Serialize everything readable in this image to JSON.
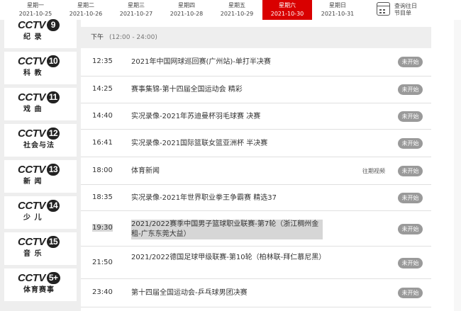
{
  "date_bar": {
    "days": [
      {
        "weekday": "星期一",
        "date": "2021-10-25",
        "active": false
      },
      {
        "weekday": "星期二",
        "date": "2021-10-26",
        "active": false
      },
      {
        "weekday": "星期三",
        "date": "2021-10-27",
        "active": false
      },
      {
        "weekday": "星期四",
        "date": "2021-10-28",
        "active": false
      },
      {
        "weekday": "星期五",
        "date": "2021-10-29",
        "active": false
      },
      {
        "weekday": "星期六",
        "date": "2021-10-30",
        "active": true
      },
      {
        "weekday": "星期日",
        "date": "2021-10-31",
        "active": false
      }
    ],
    "calendar_line1": "查询往日",
    "calendar_line2": "节目单",
    "active_color": "#d90000"
  },
  "channels": [
    {
      "logo": "CCTV",
      "num": "9",
      "sub": "纪 录"
    },
    {
      "logo": "CCTV",
      "num": "10",
      "sub": "科 教"
    },
    {
      "logo": "CCTV",
      "num": "11",
      "sub": "戏 曲"
    },
    {
      "logo": "CCTV",
      "num": "12",
      "sub": "社会与法"
    },
    {
      "logo": "CCTV",
      "num": "13",
      "sub": "新 闻"
    },
    {
      "logo": "CCTV",
      "num": "14",
      "sub": "少 儿"
    },
    {
      "logo": "CCTV",
      "num": "15",
      "sub": "音 乐"
    },
    {
      "logo": "CCTV",
      "num": "5+",
      "sub": "体育赛事"
    }
  ],
  "schedule": {
    "period": "下午",
    "period_range": "(12:00 - 24:00)",
    "programs": [
      {
        "time": "12:35",
        "title": "2021年中国网球巡回赛(广州站)-单打半决赛",
        "status": "未开始",
        "replay": "",
        "highlight": false
      },
      {
        "time": "14:25",
        "title": "赛事集锦-第十四届全国运动会 精彩",
        "status": "未开始",
        "replay": "",
        "highlight": false
      },
      {
        "time": "14:40",
        "title": "实况录像-2021年苏迪曼杯羽毛球赛 决赛",
        "status": "未开始",
        "replay": "",
        "highlight": false
      },
      {
        "time": "16:41",
        "title": "实况录像-2021国际篮联女篮亚洲杯 半决赛",
        "status": "未开始",
        "replay": "",
        "highlight": false
      },
      {
        "time": "18:00",
        "title": "体育新闻",
        "status": "未开始",
        "replay": "往期视频",
        "highlight": false
      },
      {
        "time": "18:35",
        "title": "实况录像-2021年世界职业拳王争霸赛 精选37",
        "status": "未开始",
        "replay": "",
        "highlight": false
      },
      {
        "time": "19:30",
        "title": "2021/2022赛季中国男子篮球职业联赛-第7轮（浙江稠州金租-广东东莞大益）",
        "status": "未开始",
        "replay": "",
        "highlight": true
      },
      {
        "time": "21:50",
        "title": "2021/2022德国足球甲级联赛-第10轮（柏林联-拜仁慕尼黑）",
        "status": "未开始",
        "replay": "",
        "highlight": false
      },
      {
        "time": "23:40",
        "title": "第十四届全国运动会-乒乓球男团决赛",
        "status": "未开始",
        "replay": "",
        "highlight": false
      }
    ]
  }
}
